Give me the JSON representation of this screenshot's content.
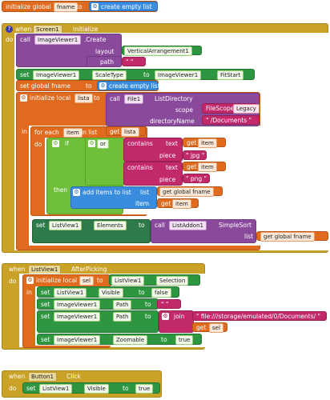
{
  "init_global": {
    "prefix": "initialize global",
    "name": "fname",
    "to": "to",
    "value": "create empty list"
  },
  "screen_init": {
    "when": "when",
    "component": "Screen1",
    "event": "Initialize",
    "do": "do"
  },
  "create_call": {
    "call": "call",
    "component": "ImageViewer1",
    ".method": ".Create",
    "layout_label": "layout",
    "layout_value": "VerticalArrangement1",
    "path_label": "path",
    "path_value": "\" \""
  },
  "set_scaletype": {
    "set": "set",
    "component": "ImageViewer1",
    "prop": "ScaleType",
    "to": "to",
    "value_component": "ImageViewer1",
    "value": "FitStart"
  },
  "set_fname": {
    "set": "set global fname",
    "to": "to",
    "value": "create empty list"
  },
  "init_local_lista": {
    "prefix": "initialize local",
    "name": "lista",
    "to": "to",
    "call": "call",
    "component": "File1",
    "method": "ListDirectory",
    "scope_label": "scope",
    "scope_value": "FileScope",
    "scope_option": "Legacy",
    "dir_label": "directoryName",
    "dir_value": "\" /Documents \"",
    "in": "in"
  },
  "foreach": {
    "for_each": "for each",
    "item": "item",
    "in_list": "in list",
    "get": "get",
    "list_var": "lista",
    "do": "do"
  },
  "if_block": {
    "if": "if",
    "or": "or",
    "contains1": "contains",
    "text1": "text",
    "get1": "get",
    "item1": "item",
    "piece1": "piece",
    "piece1_val": "\" jpg \"",
    "contains2": "contains",
    "text2": "text",
    "get2": "get",
    "item2": "item",
    "piece2": "piece",
    "piece2_val": "\" png \"",
    "then": "then"
  },
  "add_items": {
    "label": "add items to list",
    "list": "list",
    "get_fname": "get global fname",
    "item": "item",
    "get_item": "get",
    "item_var": "item"
  },
  "set_elements": {
    "set": "set",
    "component": "ListView1",
    "prop": "Elements",
    "to": "to",
    "call": "call",
    "addon": "ListAddon1",
    "method": "SimpleSort",
    "list": "list",
    "get": "get global fname"
  },
  "after_picking": {
    "when": "when",
    "component": "ListView1",
    "event": "AfterPicking",
    "do": "do"
  },
  "init_local_sel": {
    "prefix": "initialize local",
    "name": "sel",
    "to": "to",
    "component": "ListView1",
    "prop": "Selection",
    "in": "in"
  },
  "set_visible": {
    "set": "set",
    "component": "ListView1",
    "prop": "Visible",
    "to": "to",
    "value": "false"
  },
  "set_path1": {
    "set": "set",
    "component": "ImageViewer1",
    "prop": "Path",
    "to": "to",
    "value": "\" \""
  },
  "set_path2": {
    "set": "set",
    "component": "ImageViewer1",
    "prop": "Path",
    "to": "to",
    "join": "join",
    "join_a": "\" file:///storage/emulated/0/Documents/ \"",
    "join_b_get": "get",
    "join_b_var": "sel"
  },
  "set_zoomable": {
    "set": "set",
    "component": "ImageViewer1",
    "prop": "Zoomable",
    "to": "to",
    "value": "true"
  },
  "button_click": {
    "when": "when",
    "component": "Button1",
    "event": "Click",
    "do": "do"
  },
  "set_visible2": {
    "set": "set",
    "component": "ListView1",
    "prop": "Visible",
    "to": "to",
    "value": "true"
  }
}
